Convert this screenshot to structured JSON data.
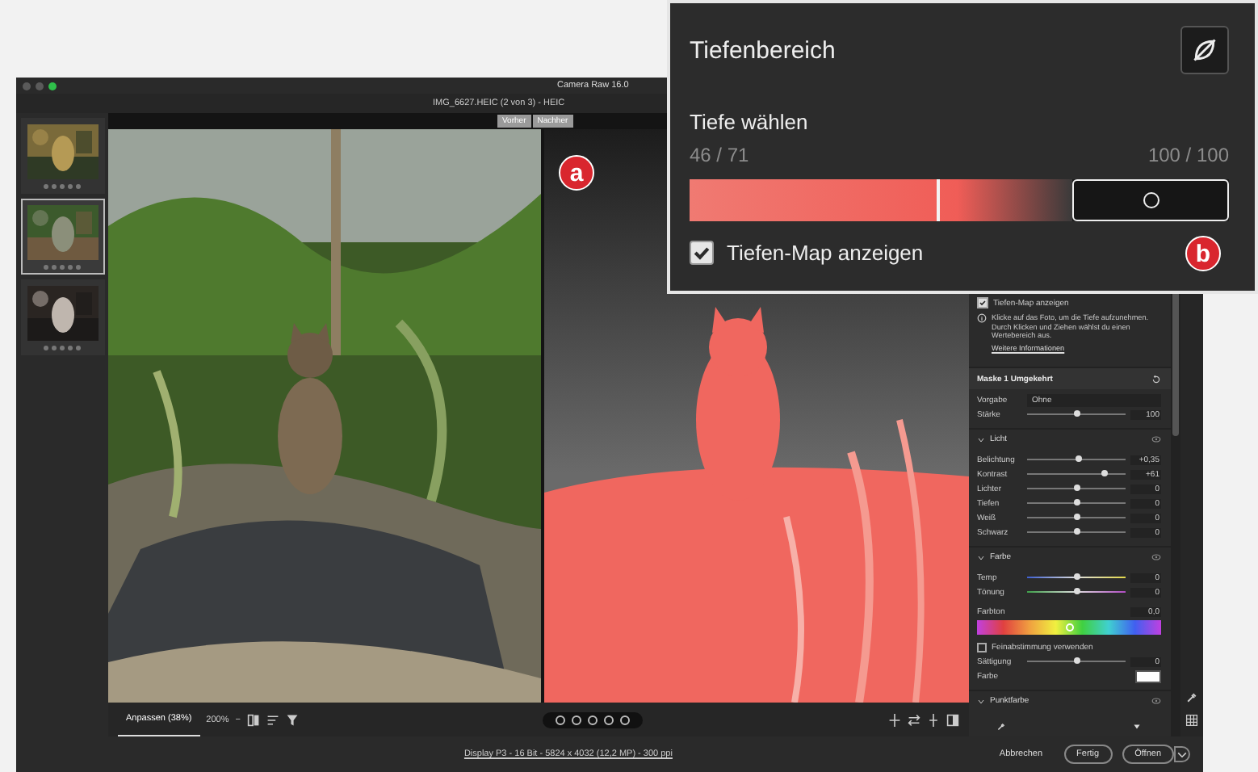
{
  "window": {
    "title": "Camera Raw 16.0",
    "file": "IMG_6627.HEIC (2 von 3) - HEIC"
  },
  "compare_buttons": [
    "Vorher",
    "Nachher"
  ],
  "filmstrip": [
    {
      "selected": false,
      "stars": 0
    },
    {
      "selected": true,
      "stars": 0
    },
    {
      "selected": false,
      "stars": 0
    }
  ],
  "callouts": [
    "a",
    "b"
  ],
  "popup": {
    "title": "Tiefenbereich",
    "label": "Tiefe wählen",
    "reading_left": "46 / 71",
    "reading_right": "100 / 100",
    "depth_marker": {
      "level": 0.46
    },
    "range_start": {
      "level": 0.71
    },
    "checkbox": {
      "label": "Tiefen-Map anzeigen",
      "checked": true
    }
  },
  "panel": {
    "checkbox": {
      "label": "Tiefen-Map anzeigen",
      "checked": true
    },
    "hint": "Klicke auf das Foto, um die Tiefe aufzunehmen. Durch Klicken und Ziehen wählst du einen Wertebereich aus.",
    "link": "Weitere Informationen",
    "mask_title": "Maske 1 Umgekehrt",
    "preset": {
      "label": "Vorgabe",
      "value": "Ohne"
    },
    "amount": {
      "label": "Stärke",
      "level": 0.5,
      "value": "100"
    },
    "sections": [
      {
        "title": "Licht",
        "expanded": true,
        "items": [
          {
            "kind": "slider",
            "label": "Belichtung",
            "level": 0.52,
            "value": "+0,35"
          },
          {
            "kind": "slider",
            "label": "Kontrast",
            "level": 0.78,
            "value": "+61"
          },
          {
            "kind": "slider",
            "label": "Lichter",
            "level": 0.5,
            "value": "0"
          },
          {
            "kind": "slider",
            "label": "Tiefen",
            "level": 0.5,
            "value": "0"
          },
          {
            "kind": "slider",
            "label": "Weiß",
            "level": 0.5,
            "value": "0"
          },
          {
            "kind": "slider",
            "label": "Schwarz",
            "level": 0.5,
            "value": "0"
          }
        ]
      },
      {
        "title": "Farbe",
        "expanded": true,
        "items": [
          {
            "kind": "temp",
            "label": "Temp",
            "level": 0.5,
            "value": "0"
          },
          {
            "kind": "tint",
            "label": "Tönung",
            "level": 0.5,
            "value": "0"
          },
          {
            "kind": "hue",
            "label": "Farbton",
            "level": 0.5,
            "value": "0,0"
          },
          {
            "kind": "checkbox",
            "label": "Feinabstimmung verwenden",
            "checked": false
          },
          {
            "kind": "slider",
            "label": "Sättigung",
            "level": 0.5,
            "value": "0"
          },
          {
            "kind": "swatch",
            "label": "Farbe",
            "color": "#ffffff"
          }
        ]
      },
      {
        "title": "Punktfarbe",
        "expanded": true
      }
    ]
  },
  "toolbar": {
    "fit_tab": {
      "label": "Anpassen (38%)",
      "selected": true
    },
    "zoom": "200%",
    "zoom_menu": "−",
    "stars": 0
  },
  "footer": {
    "info": "Display P3 - 16 Bit - 5824 x 4032 (12,2 MP) - 300 ppi",
    "buttons": [
      "Abbrechen",
      "Fertig",
      "Öffnen"
    ]
  }
}
